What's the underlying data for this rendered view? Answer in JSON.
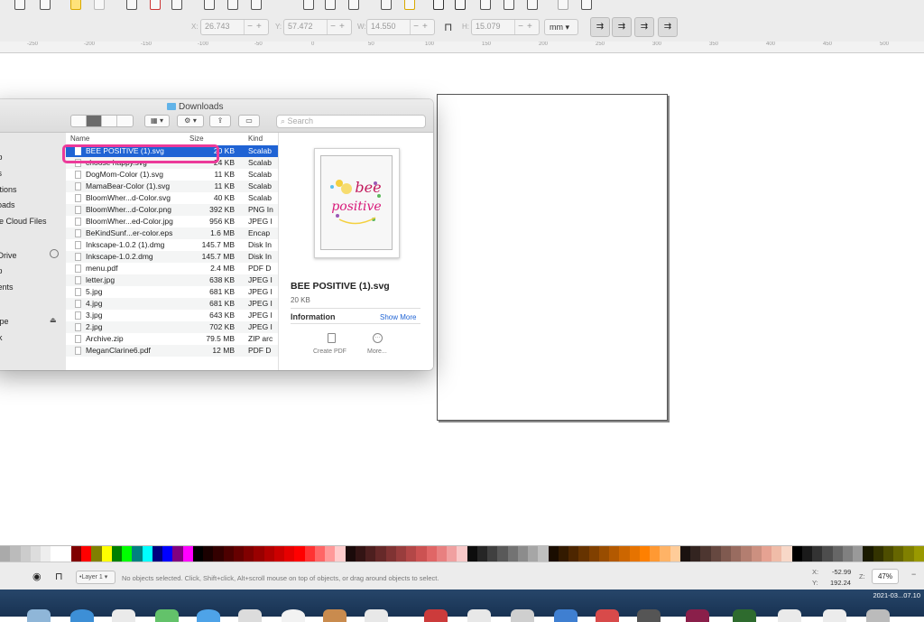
{
  "controls": {
    "x_label": "X:",
    "x_value": "26.743",
    "y_label": "Y:",
    "y_value": "57.472",
    "w_label": "W:",
    "w_value": "14.550",
    "h_label": "H:",
    "h_value": "15.079",
    "units": "mm"
  },
  "ruler": [
    "-250",
    "-200",
    "-150",
    "-100",
    "-50",
    "0",
    "50",
    "100",
    "150",
    "200",
    "250",
    "300",
    "350",
    "400",
    "450",
    "500"
  ],
  "finder": {
    "title": "Downloads",
    "search_placeholder": "Search",
    "sidebar": [
      "top",
      "nts",
      "cations",
      "nloads",
      "tive Cloud Files",
      "d Drive",
      "top",
      "ments",
      "cape",
      "ork"
    ],
    "columns": {
      "name": "Name",
      "size": "Size",
      "kind": "Kind"
    },
    "files": [
      {
        "name": "BEE POSITIVE (1).svg",
        "size": "20 KB",
        "kind": "Scalab",
        "selected": true
      },
      {
        "name": "choose happy.svg",
        "size": "24 KB",
        "kind": "Scalab"
      },
      {
        "name": "DogMom-Color (1).svg",
        "size": "11 KB",
        "kind": "Scalab"
      },
      {
        "name": "MamaBear-Color (1).svg",
        "size": "11 KB",
        "kind": "Scalab"
      },
      {
        "name": "BloomWher...d-Color.svg",
        "size": "40 KB",
        "kind": "Scalab"
      },
      {
        "name": "BloomWher...d-Color.png",
        "size": "392 KB",
        "kind": "PNG In"
      },
      {
        "name": "BloomWher...ed-Color.jpg",
        "size": "956 KB",
        "kind": "JPEG I"
      },
      {
        "name": "BeKindSunf...er-color.eps",
        "size": "1.6 MB",
        "kind": "Encap"
      },
      {
        "name": "Inkscape-1.0.2 (1).dmg",
        "size": "145.7 MB",
        "kind": "Disk In"
      },
      {
        "name": "Inkscape-1.0.2.dmg",
        "size": "145.7 MB",
        "kind": "Disk In"
      },
      {
        "name": "menu.pdf",
        "size": "2.4 MB",
        "kind": "PDF D"
      },
      {
        "name": "letter.jpg",
        "size": "638 KB",
        "kind": "JPEG I"
      },
      {
        "name": "5.jpg",
        "size": "681 KB",
        "kind": "JPEG I"
      },
      {
        "name": "4.jpg",
        "size": "681 KB",
        "kind": "JPEG I"
      },
      {
        "name": "3.jpg",
        "size": "643 KB",
        "kind": "JPEG I"
      },
      {
        "name": "2.jpg",
        "size": "702 KB",
        "kind": "JPEG I"
      },
      {
        "name": "Archive.zip",
        "size": "79.5 MB",
        "kind": "ZIP arc"
      },
      {
        "name": "MeganClarine6.pdf",
        "size": "12 MB",
        "kind": "PDF D"
      }
    ],
    "preview": {
      "artwork_word1": "bee",
      "artwork_word2": "positive",
      "filename": "BEE POSITIVE (1).svg",
      "filesize": "20 KB",
      "info_label": "Information",
      "show_more": "Show More",
      "create_pdf": "Create PDF",
      "more": "More..."
    }
  },
  "status": {
    "layer": "•Layer 1",
    "message": "No objects selected. Click, Shift+click, Alt+scroll mouse on top of objects, or drag around objects to select.",
    "x_label": "X:",
    "x_value": "-52.99",
    "y_label": "Y:",
    "y_value": "192.24",
    "z_label": "Z:",
    "zoom": "47%"
  },
  "clock": "2021-03...07.10",
  "palette": [
    "#aaaaaa",
    "#bbbbbb",
    "#cccccc",
    "#dddddd",
    "#eeeeee",
    "#ffffff",
    "#ffffff",
    "#800000",
    "#ff0000",
    "#808000",
    "#ffff00",
    "#008000",
    "#00ff00",
    "#008080",
    "#00ffff",
    "#000080",
    "#0000ff",
    "#800080",
    "#ff00ff",
    "#000000",
    "#1a0000",
    "#330000",
    "#4d0000",
    "#660000",
    "#800000",
    "#990000",
    "#b30000",
    "#cc0000",
    "#e60000",
    "#ff0000",
    "#ff3333",
    "#ff6666",
    "#ff9999",
    "#ffcccc",
    "#1a0a0a",
    "#331414",
    "#4d1f1f",
    "#662929",
    "#803333",
    "#993d3d",
    "#b34747",
    "#cc5252",
    "#e06666",
    "#e88080",
    "#f0a0a0",
    "#f8c8c8",
    "#0d0d0d",
    "#262626",
    "#404040",
    "#595959",
    "#737373",
    "#8c8c8c",
    "#a6a6a6",
    "#bfbfbf",
    "#1a0d00",
    "#331a00",
    "#4d2600",
    "#663300",
    "#804000",
    "#994d00",
    "#b35900",
    "#cc6600",
    "#e67300",
    "#ff8000",
    "#ff9933",
    "#ffb366",
    "#ffcc99",
    "#1a1210",
    "#332420",
    "#4d3630",
    "#664840",
    "#805a50",
    "#996c60",
    "#b37e70",
    "#cc9080",
    "#e6a292",
    "#f0bca8",
    "#f8d8c8",
    "#000000",
    "#1a1a1a",
    "#333333",
    "#4d4d4d",
    "#666666",
    "#808080",
    "#999999",
    "#1a1a00",
    "#333300",
    "#4d4d00",
    "#666600",
    "#808000",
    "#999900"
  ]
}
